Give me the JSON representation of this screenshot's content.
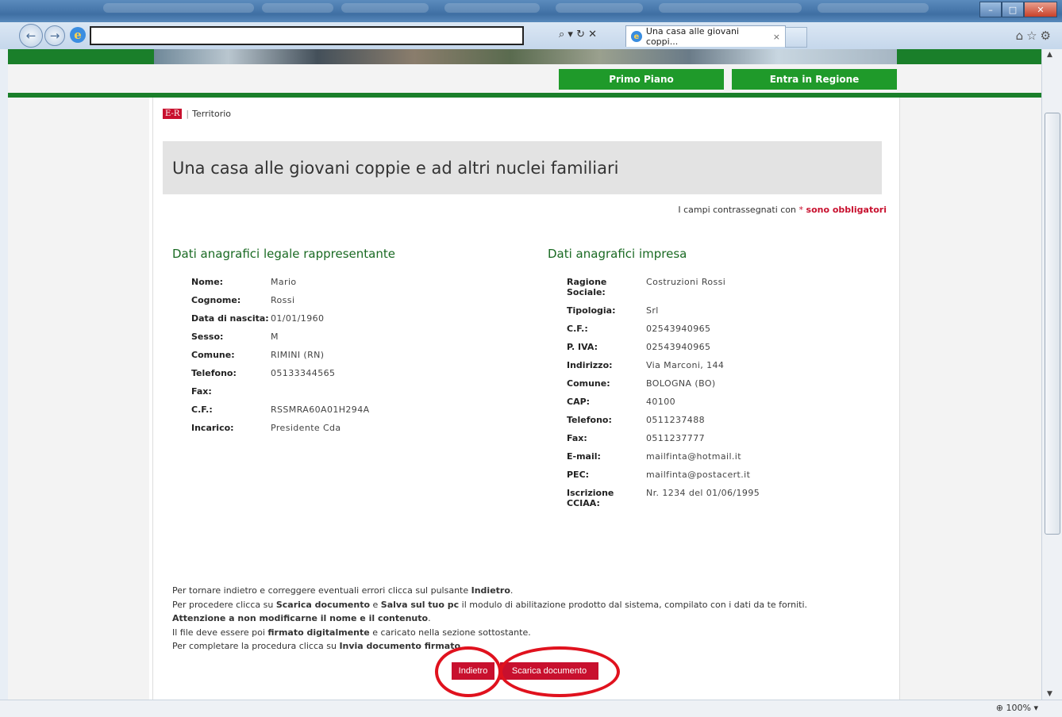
{
  "browser": {
    "tab_title": "Una casa alle giovani coppi...",
    "tab_close": "×",
    "zoom": "100%",
    "zoom_icon": "⊕",
    "addr_tools": "⌕ ▾ ↻ ✕",
    "right_tools": "⌂☆⚙"
  },
  "site": {
    "nav": {
      "primo_piano": "Primo Piano",
      "entra_regione": "Entra in Regione"
    },
    "breadcrumb": {
      "logo": "E-R",
      "separator": "|",
      "section": "Territorio"
    }
  },
  "page": {
    "title": "Una casa alle giovani coppie e ad altri nuclei familiari",
    "required_prefix": "I campi contrassegnati con",
    "required_star": "*",
    "required_suffix": "sono obbligatori"
  },
  "legale": {
    "heading": "Dati anagrafici legale rappresentante",
    "fields": [
      {
        "label": "Nome:",
        "value": "Mario"
      },
      {
        "label": "Cognome:",
        "value": "Rossi"
      },
      {
        "label": "Data di nascita:",
        "value": "01/01/1960"
      },
      {
        "label": "Sesso:",
        "value": "M"
      },
      {
        "label": "Comune:",
        "value": "RIMINI (RN)"
      },
      {
        "label": "Telefono:",
        "value": "05133344565"
      },
      {
        "label": "Fax:",
        "value": ""
      },
      {
        "label": "C.F.:",
        "value": "RSSMRA60A01H294A"
      },
      {
        "label": "Incarico:",
        "value": "Presidente Cda"
      }
    ]
  },
  "impresa": {
    "heading": "Dati anagrafici impresa",
    "fields": [
      {
        "label": "Ragione Sociale:",
        "value": "Costruzioni Rossi"
      },
      {
        "label": "Tipologia:",
        "value": "Srl"
      },
      {
        "label": "C.F.:",
        "value": "02543940965"
      },
      {
        "label": "P. IVA:",
        "value": "02543940965"
      },
      {
        "label": "Indirizzo:",
        "value": "Via Marconi, 144"
      },
      {
        "label": "Comune:",
        "value": "BOLOGNA (BO)"
      },
      {
        "label": "CAP:",
        "value": "40100"
      },
      {
        "label": "Telefono:",
        "value": "0511237488"
      },
      {
        "label": "Fax:",
        "value": "0511237777"
      },
      {
        "label": "E-mail:",
        "value": "mailfinta@hotmail.it"
      },
      {
        "label": "PEC:",
        "value": "mailfinta@postacert.it"
      },
      {
        "label": "Iscrizione CCIAA:",
        "value": "Nr. 1234 del 01/06/1995"
      }
    ]
  },
  "instructions": {
    "l1a": "Per tornare indietro e correggere eventuali errori clicca sul pulsante ",
    "l1b": "Indietro",
    "l1c": ".",
    "l2a": "Per procedere clicca su ",
    "l2b": "Scarica documento",
    "l2c": " e ",
    "l2d": "Salva sul tuo pc",
    "l2e": " il modulo di abilitazione prodotto dal sistema, compilato con i dati da te forniti.",
    "l3": "Attenzione a non modificarne il nome e il contenuto",
    "l3end": ".",
    "l4a": "Il file deve essere poi ",
    "l4b": "firmato digitalmente",
    "l4c": " e caricato nella sezione sottostante.",
    "l5a": "Per completare la procedura clicca su ",
    "l5b": "Invia documento firmato",
    "l5c": "."
  },
  "buttons": {
    "indietro": "Indietro",
    "scarica": "Scarica documento"
  },
  "colors": {
    "brand_green": "#1a7f2a",
    "accent_red": "#c8102e",
    "annotation_red": "#e0121e"
  }
}
